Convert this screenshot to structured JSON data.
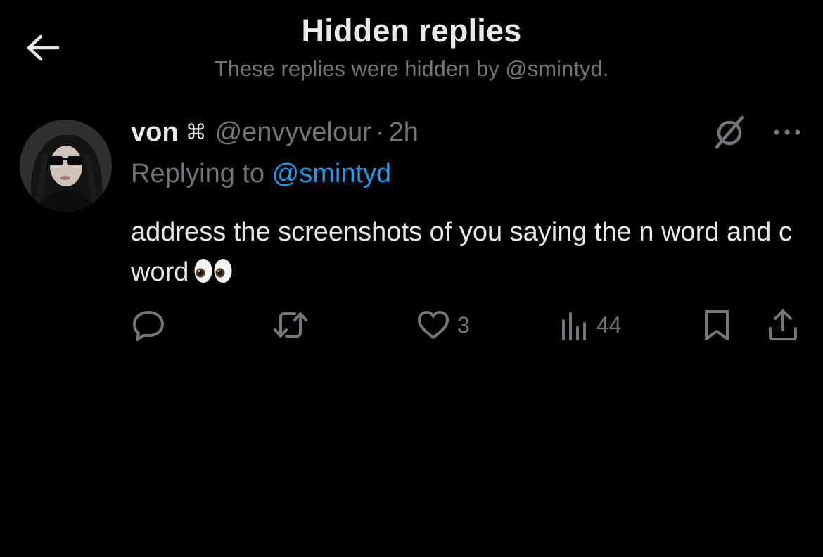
{
  "header": {
    "title": "Hidden replies",
    "subtitle": "These replies were hidden by @smintyd."
  },
  "tweet": {
    "display_name": "von",
    "name_glyph": "⌘",
    "handle": "@envyvelour",
    "separator": "·",
    "timestamp": "2h",
    "replying_prefix": "Replying to",
    "replying_to": "@smintyd",
    "text": "address the screenshots of you saying the n word and c word",
    "emoji": "eyes"
  },
  "actions": {
    "reply_count": "",
    "retweet_count": "",
    "like_count": "3",
    "view_count": "44"
  },
  "icons": {
    "back": "arrow-left-icon",
    "hidden": "hidden-reply-icon",
    "more": "more-horizontal-icon",
    "reply": "reply-icon",
    "retweet": "retweet-icon",
    "like": "heart-icon",
    "views": "views-icon",
    "bookmark": "bookmark-icon",
    "share": "share-icon"
  },
  "colors": {
    "background": "#000000",
    "text_primary": "#e7e9ea",
    "text_secondary": "#71767b",
    "accent": "#1d9bf0"
  }
}
